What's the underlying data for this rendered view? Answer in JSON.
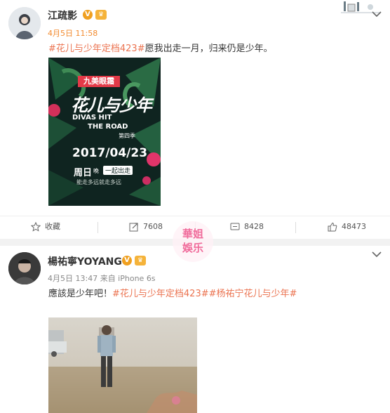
{
  "post1": {
    "username": "江疏影",
    "verified_badge": "V",
    "member_badge": "♛",
    "timestamp": "4月5日 11:58",
    "hashtag": "#花儿与少年定档423#",
    "text": "愿我出走一月，归来仍是少年。",
    "poster": {
      "brand": "九美眼霜",
      "title": "花儿与少年",
      "subtitle_en_1": "DIVAS HIT",
      "subtitle_en_2": "THE ROAD",
      "season": "第四季",
      "date": "2017/04/23",
      "day": "周日",
      "time_label": "晚",
      "tagline": "一起出走",
      "slogan": "能走多远就走多远"
    },
    "actions": {
      "favorite": "收藏",
      "repost": "7608",
      "comment": "8428",
      "like": "48473"
    }
  },
  "watermark": {
    "line1": "華姐",
    "line2": "娛乐"
  },
  "post2": {
    "username": "楊祐寧YOYANG",
    "verified_badge": "V",
    "member_badge": "♛",
    "timestamp": "4月5日 13:47 来自 iPhone 6s",
    "text_prefix": "應該是少年吧！",
    "hashtag1": "#花儿与少年定档423#",
    "hashtag2": "#杨祐宁花儿与少年#"
  },
  "colors": {
    "accent": "#eb7350",
    "time": "#f28a2e",
    "verified": "#f0a020"
  }
}
